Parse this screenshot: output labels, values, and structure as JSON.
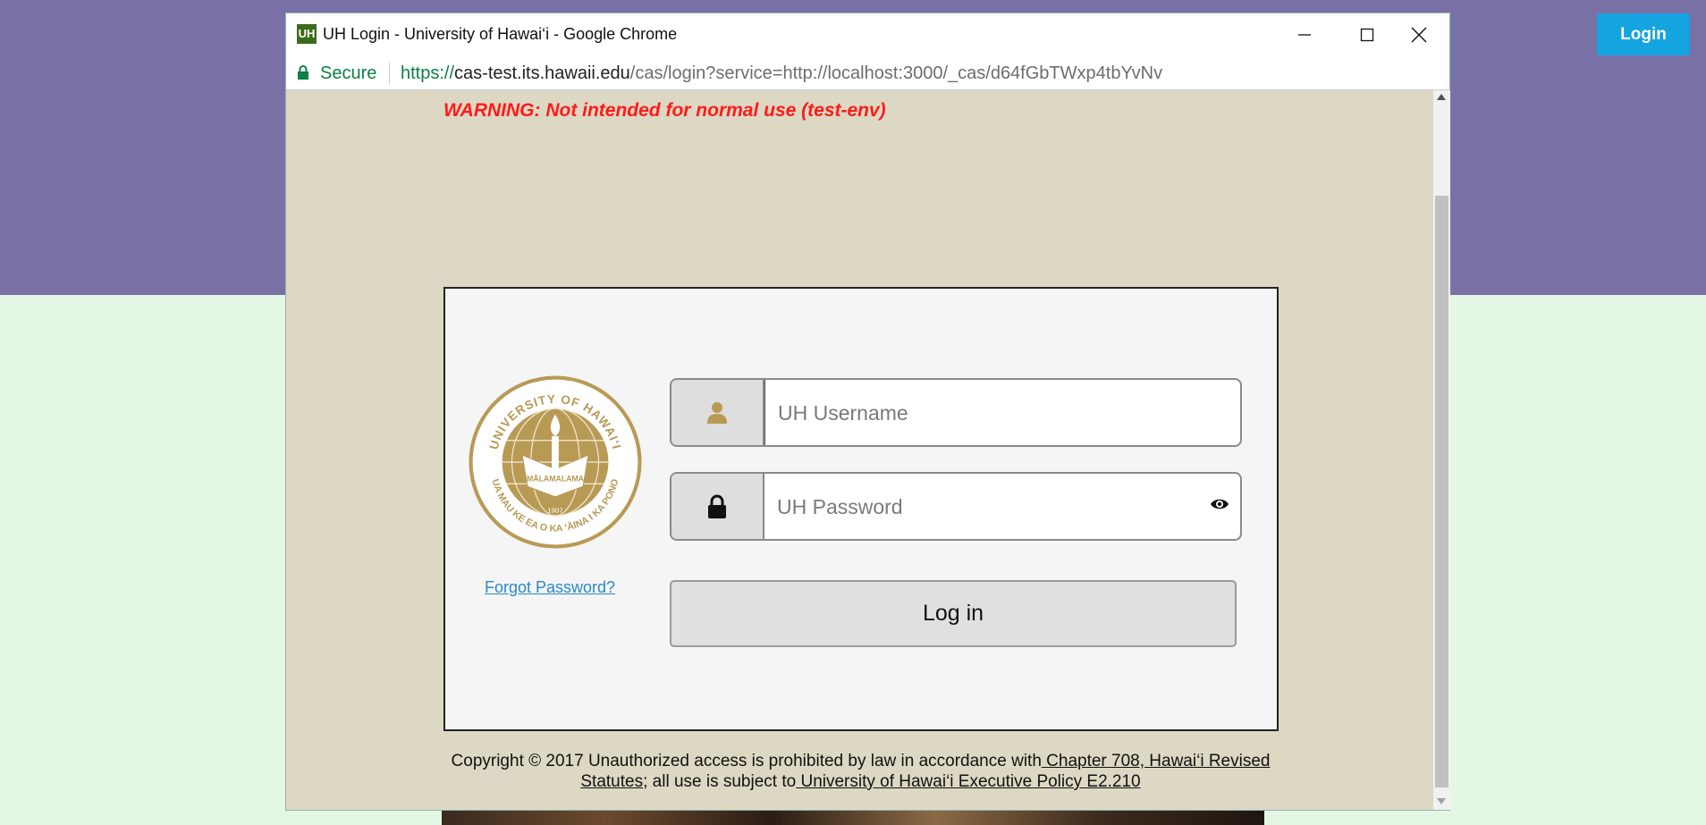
{
  "site": {
    "login_button": "Login",
    "colors": {
      "header_bg": "#7971a6",
      "body_bg": "#e4f7e4",
      "login_button_bg": "#14a4e0"
    }
  },
  "popup": {
    "favicon_text": "UH",
    "window_title": "UH Login - University of Hawai‘i - Google Chrome",
    "secure_label": "Secure",
    "url_scheme": "https://",
    "url_host": "cas-test.its.hawaii.edu",
    "url_path": "/cas/login?service=http://localhost:3000/_cas/d64fGbTWxp4tbYvNv"
  },
  "page": {
    "warning": "WARNING: Not intended for normal use (test-env)",
    "seal": {
      "top_text": "UNIVERSITY OF HAWAI‘I",
      "bottom_text": "UA MAU KE EA O KA ‘ĀINA I KA PONO",
      "motto": "MĀLAMALAMA",
      "year": "1907"
    },
    "forgot_password": "Forgot Password?",
    "username_placeholder": "UH Username",
    "password_placeholder": "UH Password",
    "login_button": "Log in",
    "footer": {
      "text_1": "Copyright © 2017 Unauthorized access is prohibited by law in accordance with",
      "link_1": " Chapter 708, Hawai‘i Revised Statutes",
      "text_2": "; all use is subject to",
      "link_2": " University of Hawai‘i Executive Policy E2.210"
    },
    "colors": {
      "content_bg": "#ddd8c3",
      "warning": "#ff1a1a",
      "seal_gold": "#b89a55",
      "link": "#2a89c8"
    }
  }
}
